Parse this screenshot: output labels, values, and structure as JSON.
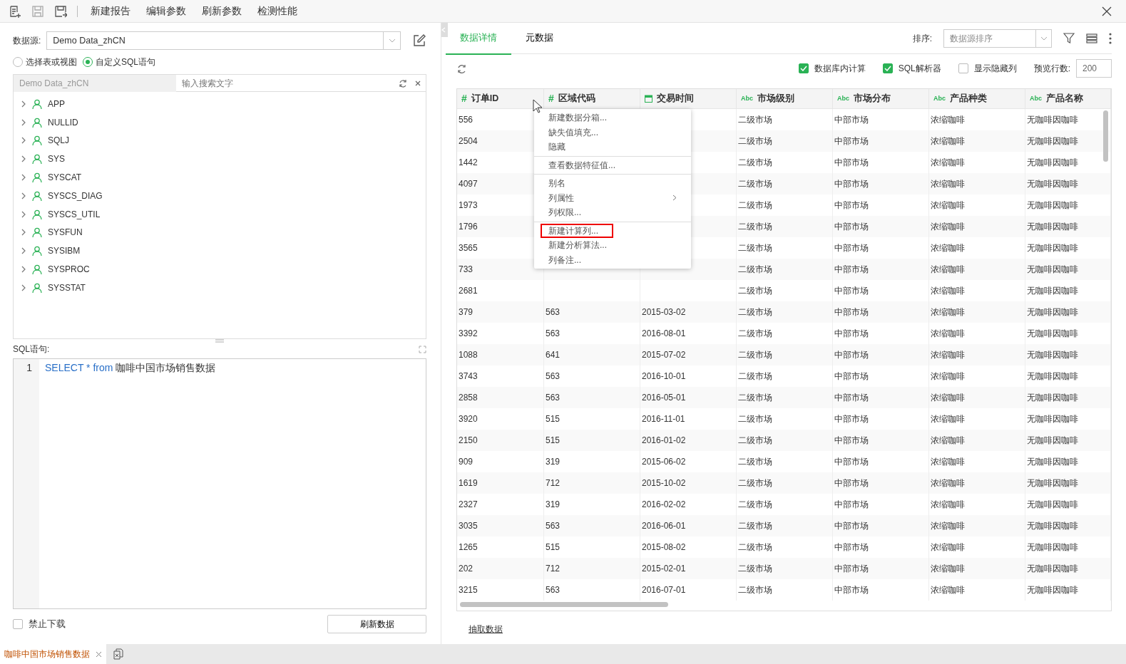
{
  "toolbar": {
    "actions": [
      "新建报告",
      "编辑参数",
      "刷新参数",
      "检测性能"
    ]
  },
  "left": {
    "source_label": "数据源:",
    "source_value": "Demo Data_zhCN",
    "modes": [
      {
        "label": "选择表或视图",
        "selected": false
      },
      {
        "label": "自定义SQL语句",
        "selected": true
      }
    ],
    "tree_source": "Demo Data_zhCN",
    "tree_search_placeholder": "输入搜索文字",
    "tree": [
      {
        "label": "APP",
        "expanded": false
      },
      {
        "label": "NULLID",
        "expanded": false
      },
      {
        "label": "SQLJ",
        "expanded": false
      },
      {
        "label": "SYS",
        "expanded": false
      },
      {
        "label": "SYSCAT",
        "expanded": false
      },
      {
        "label": "SYSCS_DIAG",
        "expanded": false
      },
      {
        "label": "SYSCS_UTIL",
        "expanded": false
      },
      {
        "label": "SYSFUN",
        "expanded": false
      },
      {
        "label": "SYSIBM",
        "expanded": false
      },
      {
        "label": "SYSPROC",
        "expanded": false
      },
      {
        "label": "SYSSTAT",
        "expanded": false
      }
    ],
    "sql_label": "SQL语句:",
    "sql_lines": [
      {
        "number": "1",
        "tokens": [
          {
            "text": "SELECT",
            "kind": "keyword"
          },
          {
            "text": "*",
            "kind": "keyword"
          },
          {
            "text": "from",
            "kind": "keyword"
          },
          {
            "text": "咖啡中国市场销售数据",
            "kind": "plain"
          }
        ]
      }
    ],
    "disable_download": {
      "label": "禁止下载",
      "checked": false
    },
    "refresh_button": "刷新数据"
  },
  "right": {
    "tabs": [
      {
        "label": "数据详情",
        "selected": true
      },
      {
        "label": "元数据",
        "selected": false
      }
    ],
    "sort_label": "排序:",
    "sort_value": "数据源排序",
    "options": [
      {
        "label": "数据库内计算",
        "checked": true
      },
      {
        "label": "SQL解析器",
        "checked": true
      },
      {
        "label": "显示隐藏列",
        "checked": false
      }
    ],
    "preview_label": "预览行数:",
    "preview_value": "200",
    "table": {
      "columns": [
        {
          "label": "订单ID",
          "kind": "number",
          "type_mark": "#"
        },
        {
          "label": "区域代码",
          "kind": "number",
          "type_mark": "#"
        },
        {
          "label": "交易时间",
          "kind": "date"
        },
        {
          "label": "市场级别",
          "kind": "text",
          "type_mark": "Abc"
        },
        {
          "label": "市场分布",
          "kind": "text",
          "type_mark": "Abc"
        },
        {
          "label": "产品种类",
          "kind": "text",
          "type_mark": "Abc"
        },
        {
          "label": "产品名称",
          "kind": "text",
          "type_mark": "Abc"
        }
      ],
      "rows": [
        {
          "cells": [
            "556",
            null,
            null,
            "二级市场",
            "中部市场",
            "浓缩咖啡",
            "无咖啡因咖啡"
          ]
        },
        {
          "cells": [
            "2504",
            null,
            null,
            "二级市场",
            "中部市场",
            "浓缩咖啡",
            "无咖啡因咖啡"
          ]
        },
        {
          "cells": [
            "1442",
            null,
            null,
            "二级市场",
            "中部市场",
            "浓缩咖啡",
            "无咖啡因咖啡"
          ]
        },
        {
          "cells": [
            "4097",
            null,
            null,
            "二级市场",
            "中部市场",
            "浓缩咖啡",
            "无咖啡因咖啡"
          ]
        },
        {
          "cells": [
            "1973",
            null,
            null,
            "二级市场",
            "中部市场",
            "浓缩咖啡",
            "无咖啡因咖啡"
          ]
        },
        {
          "cells": [
            "1796",
            null,
            null,
            "二级市场",
            "中部市场",
            "浓缩咖啡",
            "无咖啡因咖啡"
          ]
        },
        {
          "cells": [
            "3565",
            null,
            null,
            "二级市场",
            "中部市场",
            "浓缩咖啡",
            "无咖啡因咖啡"
          ]
        },
        {
          "cells": [
            "733",
            null,
            null,
            "二级市场",
            "中部市场",
            "浓缩咖啡",
            "无咖啡因咖啡"
          ]
        },
        {
          "cells": [
            "2681",
            null,
            null,
            "二级市场",
            "中部市场",
            "浓缩咖啡",
            "无咖啡因咖啡"
          ]
        },
        {
          "cells": [
            "379",
            "563",
            "2015-03-02",
            "二级市场",
            "中部市场",
            "浓缩咖啡",
            "无咖啡因咖啡"
          ]
        },
        {
          "cells": [
            "3392",
            "563",
            "2016-08-01",
            "二级市场",
            "中部市场",
            "浓缩咖啡",
            "无咖啡因咖啡"
          ]
        },
        {
          "cells": [
            "1088",
            "641",
            "2015-07-02",
            "二级市场",
            "中部市场",
            "浓缩咖啡",
            "无咖啡因咖啡"
          ]
        },
        {
          "cells": [
            "3743",
            "563",
            "2016-10-01",
            "二级市场",
            "中部市场",
            "浓缩咖啡",
            "无咖啡因咖啡"
          ]
        },
        {
          "cells": [
            "2858",
            "563",
            "2016-05-01",
            "二级市场",
            "中部市场",
            "浓缩咖啡",
            "无咖啡因咖啡"
          ]
        },
        {
          "cells": [
            "3920",
            "515",
            "2016-11-01",
            "二级市场",
            "中部市场",
            "浓缩咖啡",
            "无咖啡因咖啡"
          ]
        },
        {
          "cells": [
            "2150",
            "515",
            "2016-01-02",
            "二级市场",
            "中部市场",
            "浓缩咖啡",
            "无咖啡因咖啡"
          ]
        },
        {
          "cells": [
            "909",
            "319",
            "2015-06-02",
            "二级市场",
            "中部市场",
            "浓缩咖啡",
            "无咖啡因咖啡"
          ]
        },
        {
          "cells": [
            "1619",
            "712",
            "2015-10-02",
            "二级市场",
            "中部市场",
            "浓缩咖啡",
            "无咖啡因咖啡"
          ]
        },
        {
          "cells": [
            "2327",
            "319",
            "2016-02-02",
            "二级市场",
            "中部市场",
            "浓缩咖啡",
            "无咖啡因咖啡"
          ]
        },
        {
          "cells": [
            "3035",
            "563",
            "2016-06-01",
            "二级市场",
            "中部市场",
            "浓缩咖啡",
            "无咖啡因咖啡"
          ]
        },
        {
          "cells": [
            "1265",
            "515",
            "2015-08-02",
            "二级市场",
            "中部市场",
            "浓缩咖啡",
            "无咖啡因咖啡"
          ]
        },
        {
          "cells": [
            "202",
            "712",
            "2015-02-01",
            "二级市场",
            "中部市场",
            "浓缩咖啡",
            "无咖啡因咖啡"
          ]
        },
        {
          "cells": [
            "3215",
            "563",
            "2016-07-01",
            "二级市场",
            "中部市场",
            "浓缩咖啡",
            "无咖啡因咖啡"
          ]
        }
      ]
    },
    "context_menu": {
      "groups": [
        [
          {
            "label": "新建数据分箱...",
            "submenu": false,
            "highlighted": false
          },
          {
            "label": "缺失值填充...",
            "submenu": false,
            "highlighted": false
          },
          {
            "label": "隐藏",
            "submenu": false,
            "highlighted": false
          }
        ],
        [
          {
            "label": "查看数据特征值...",
            "submenu": false,
            "highlighted": false
          }
        ],
        [
          {
            "label": "别名",
            "submenu": false,
            "highlighted": false
          },
          {
            "label": "列属性",
            "submenu": true,
            "highlighted": false
          },
          {
            "label": "列权限...",
            "submenu": false,
            "highlighted": false
          }
        ],
        [
          {
            "label": "新建计算列...",
            "submenu": false,
            "highlighted": true
          },
          {
            "label": "新建分析算法...",
            "submenu": false,
            "highlighted": false
          },
          {
            "label": "列备注...",
            "submenu": false,
            "highlighted": false
          }
        ]
      ]
    },
    "extract_link": "抽取数据"
  },
  "bottom_tabs": [
    {
      "label": "咖啡中国市场销售数据",
      "selected": true
    }
  ]
}
